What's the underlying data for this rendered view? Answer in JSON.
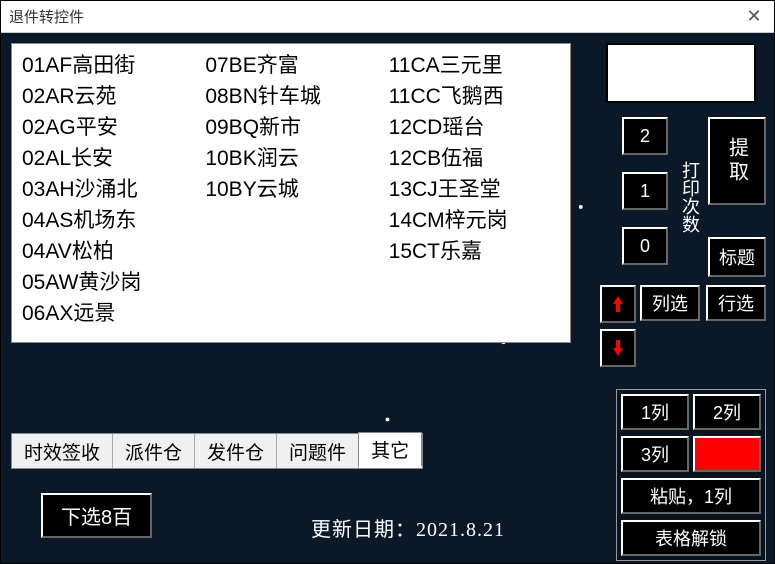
{
  "window": {
    "title": "退件转控件"
  },
  "list": {
    "col1": [
      "01AF高田街",
      "02AR云苑",
      "02AG平安",
      "02AL长安",
      "03AH沙涌北",
      "04AS机场东",
      "04AV松柏",
      "05AW黄沙岗",
      "06AX远景"
    ],
    "col2": [
      "07BE齐富",
      "08BN针车城",
      "09BQ新市",
      "10BK润云",
      "10BY云城"
    ],
    "col3": [
      "11CA三元里",
      "11CC飞鹅西",
      "12CD瑶台",
      "12CB伍福",
      "13CJ王圣堂",
      "14CM梓元岗",
      "15CT乐嘉"
    ]
  },
  "print": {
    "nums": [
      "2",
      "1",
      "0"
    ],
    "label": "打印次数",
    "extract": "提取",
    "title_btn": "标题",
    "col_sel": "列选",
    "row_sel": "行选"
  },
  "grid": {
    "c1": "1列",
    "c2": "2列",
    "c3": "3列",
    "paste": "粘贴，1列",
    "unlock": "表格解锁"
  },
  "tabs": {
    "items": [
      "时效签收",
      "派件仓",
      "发件仓",
      "问题件",
      "其它"
    ],
    "active": 4
  },
  "bottom": {
    "btn": "下选8百",
    "date_label": "更新日期：",
    "date_value": "2021.8.21"
  }
}
